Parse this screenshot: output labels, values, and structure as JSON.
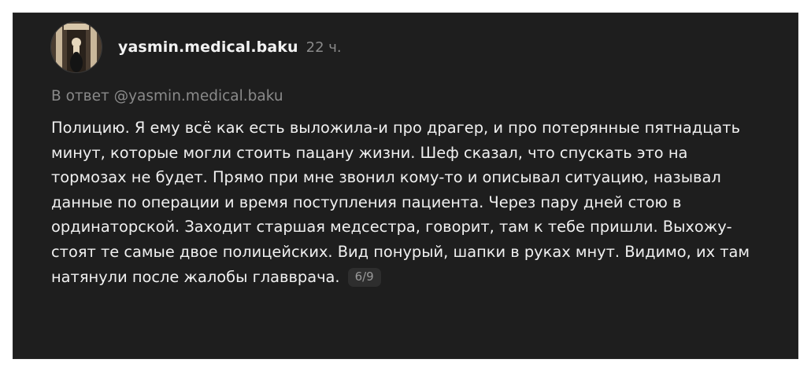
{
  "post": {
    "username": "yasmin.medical.baku",
    "time": "22 ч.",
    "reply_to": "В ответ @yasmin.medical.baku",
    "text": "Полицию. Я ему всё как есть выложила-и про драгер, и про потерянные пятнадцать минут, которые могли стоить пацану жизни. Шеф сказал, что спускать это на тормозах не будет. Прямо при мне звонил кому-то и описывал ситуацию, называл данные по операции и время поступления пациента. Через пару дней стою в ординаторской. Заходит старшая медсестра, говорит, там к тебе пришли. Выхожу-стоят те самые двое полицейских. Вид понурый, шапки в руках мнут. Видимо, их там натянули после жалобы главврача.",
    "counter": "6/9"
  },
  "colors": {
    "card_background": "#1e1e1e",
    "text_primary": "#f0f0f0",
    "text_secondary": "#8a8a8a"
  }
}
